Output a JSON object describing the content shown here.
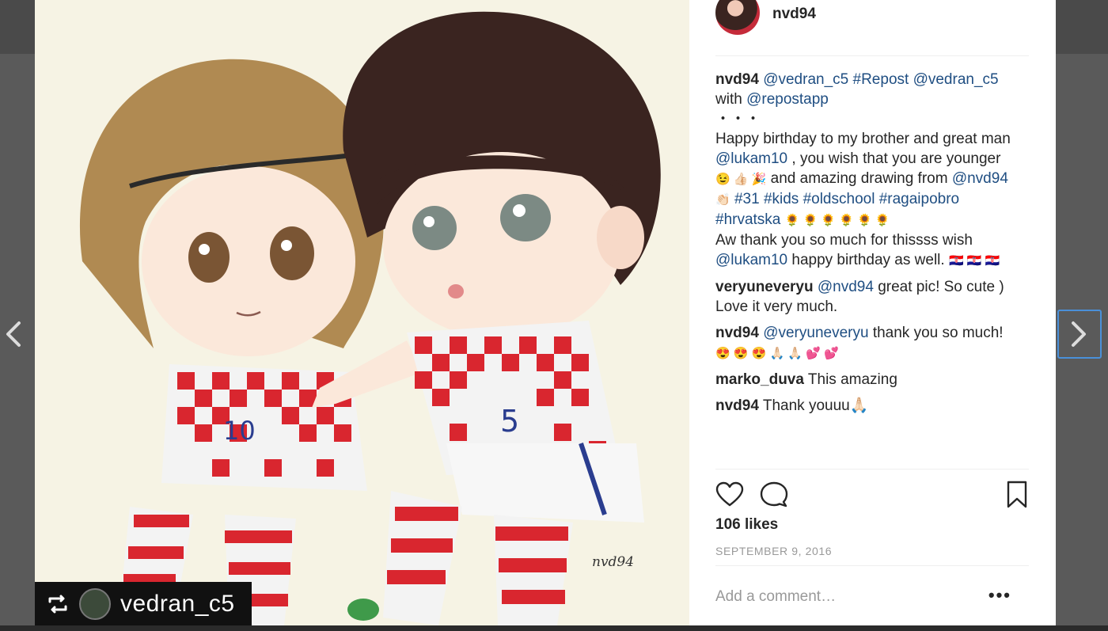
{
  "post": {
    "username": "nvd94",
    "repost_username": "vedran_c5",
    "signature": "nvd94"
  },
  "caption": {
    "user": "nvd94",
    "mention1": "@vedran_c5",
    "hashtag_repost": "#Repost",
    "mention2": "@vedran_c5",
    "with_text": "with",
    "mention_repostapp": "@repostapp",
    "dots": "・・・",
    "line_birthday": "Happy birthday to my brother and great man",
    "mention_lukam10": "@lukam10",
    "younger_text": ", you wish that you are younger",
    "emoji_row1": "😉 👍🏻 🎉",
    "amazing_text": "and amazing drawing from",
    "mention_nvd94": "@nvd94",
    "emoji_clap": "👏🏻",
    "hashtags_line": "#31 #kids #oldschool #ragaipobro",
    "hashtag_hrvatska": "#hrvatska",
    "emoji_sunflowers": "🌻 🌻 🌻 🌻 🌻 🌻",
    "reply_text": "Aw thank you so much for thissss wish",
    "mention_lukam10_b": "@lukam10",
    "happy_text": "happy birthday as well.",
    "emoji_flags": "🇭🇷 🇭🇷 🇭🇷"
  },
  "comments": [
    {
      "user": "veryuneveryu",
      "mention": "@nvd94",
      "text": "great pic! So cute )",
      "text2": "Love it very much."
    },
    {
      "user": "nvd94",
      "mention": "@veryuneveryu",
      "text": "thank you so much!",
      "emoji": "😍 😍 😍 🙏🏻 🙏🏻 💕 💕"
    },
    {
      "user": "marko_duva",
      "text": "This amazing"
    },
    {
      "user": "nvd94",
      "text": "Thank youuu🙏🏻"
    }
  ],
  "stats": {
    "likes": "106 likes",
    "date": "SEPTEMBER 9, 2016"
  },
  "add_comment": {
    "placeholder": "Add a comment…",
    "more": "•••"
  },
  "colors": {
    "link": "#1f4e82",
    "text": "#262626",
    "muted": "#999999",
    "focus_ring": "#4a90d9"
  }
}
